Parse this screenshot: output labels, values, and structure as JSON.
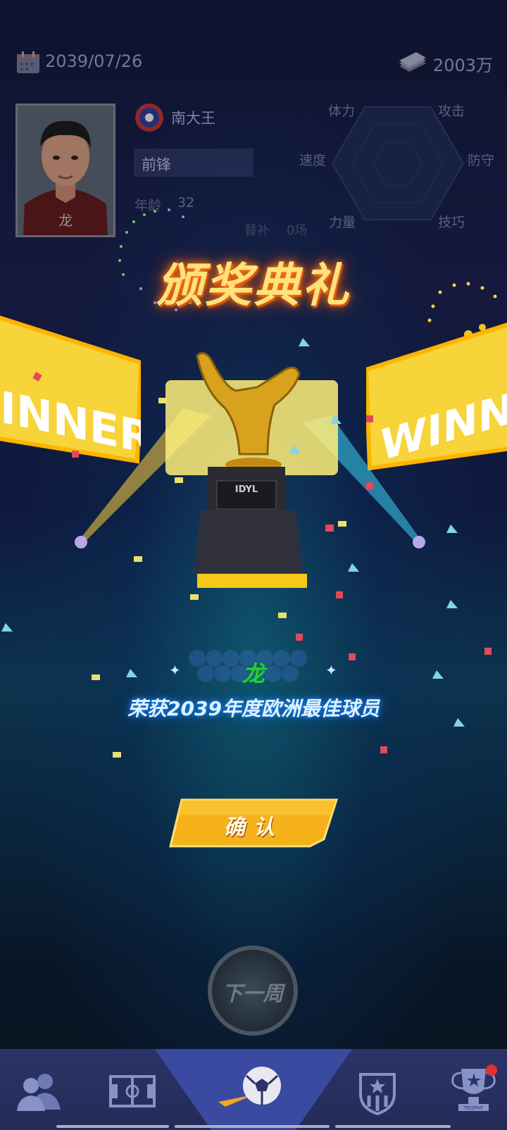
{
  "header": {
    "date": "2039/07/26",
    "money": "2003万",
    "calendar_icon": "calendar-icon",
    "money_icon": "cash-icon"
  },
  "player": {
    "avatar_name": "龙",
    "club": "南大王",
    "position": "前锋",
    "age_label": "年龄",
    "age": "32",
    "appearances_label": "替补",
    "appearances": "0场"
  },
  "stats": {
    "stamina": "体力",
    "attack": "攻击",
    "speed": "速度",
    "defense": "防守",
    "power": "力量",
    "skill": "技巧"
  },
  "ceremony": {
    "title": "颁奖典礼",
    "winner_text_left": "INNER",
    "winner_text_right": "WINN",
    "trophy_plate": "IDYL",
    "player_name": "龙",
    "award": "荣获2039年度欧洲最佳球员",
    "confirm": "确认"
  },
  "next_week": "下一周",
  "nav": {
    "items": [
      "team-icon",
      "tactics-icon",
      "match-icon",
      "club-icon",
      "trophy-icon"
    ],
    "trophy_sub": "TROPHY"
  },
  "colors": {
    "title": "#ffe27a",
    "name": "#1fd41f",
    "confirm": "#f5b21a",
    "nav": "#2b3468"
  }
}
